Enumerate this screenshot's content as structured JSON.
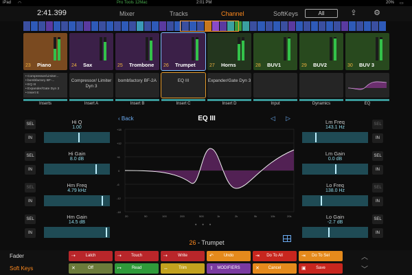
{
  "status": {
    "device": "iPad",
    "wifi": "wifi-icon",
    "app": "Pro Tools 12Mac",
    "time": "2:01 PM",
    "battery": "20%"
  },
  "topbar": {
    "clock": "2:41.399",
    "tabs": [
      {
        "label": "Mixer",
        "active": false
      },
      {
        "label": "Tracks",
        "active": false
      },
      {
        "label": "Channel",
        "active": true
      }
    ],
    "softkeys_label": "SoftKeys",
    "softkeys_value": "All",
    "share_icon": "share-icon",
    "settings_icon": "gear-icon"
  },
  "tracks": [
    {
      "num": "23",
      "name": "Piano",
      "color": "#7a4a20",
      "meters": [
        0.5,
        0.9
      ]
    },
    {
      "num": "24",
      "name": "Sax",
      "color": "#3b2048",
      "meters": [
        0.0,
        0.8
      ]
    },
    {
      "num": "25",
      "name": "Trombone",
      "color": "#3b2048",
      "meters": [
        0.0,
        0.85
      ]
    },
    {
      "num": "26",
      "name": "Trumpet",
      "color": "#3b2048",
      "meters": [
        0.0,
        0.9
      ],
      "selected": true
    },
    {
      "num": "27",
      "name": "Horns",
      "color": "#23361e",
      "meters": [
        0.7,
        0.85
      ]
    },
    {
      "num": "28",
      "name": "BUV1",
      "color": "#28491e",
      "meters": [
        0.0,
        0.95
      ]
    },
    {
      "num": "29",
      "name": "BUV2",
      "color": "#28491e",
      "meters": [
        0.0,
        0.95
      ]
    },
    {
      "num": "30",
      "name": "BUV 3",
      "color": "#28491e",
      "meters": [
        0.0,
        0.9
      ]
    }
  ],
  "inserts": {
    "list": [
      "• Compressor/Limiter...",
      "• bombfactory BF-...",
      "• EQ III",
      "• Expander/Gate Dyn 3",
      "• Insert E"
    ],
    "list_label": "Inserts",
    "items": [
      {
        "text": "Compressor/ Limiter Dyn 3",
        "label": "Insert A"
      },
      {
        "text": "bombfactory BF-2A",
        "label": "Insert B"
      },
      {
        "text": "EQ III",
        "label": "Insert C",
        "selected": true
      },
      {
        "text": "Expander/Gate Dyn 3",
        "label": "Insert D"
      }
    ],
    "extra": [
      {
        "label": "Input"
      },
      {
        "label": "Dynamics"
      },
      {
        "label": "EQ"
      }
    ]
  },
  "left_controls": [
    {
      "btn": "SEL",
      "name": "Hi Q",
      "value": "1.00",
      "pos": 0.52,
      "btn_dim": false
    },
    {
      "btn": "IN",
      "second_btn": true,
      "btn_dim": false
    },
    {
      "btn": "SEL",
      "name": "Hi Gain",
      "value": "8.0 dB",
      "pos": 0.78,
      "btn_dim": false
    },
    {
      "btn": "IN",
      "second_btn": true,
      "btn_dim": false
    },
    {
      "btn": "SEL",
      "name": "Hm Freq",
      "value": "4.79 kHz",
      "pos": 0.88,
      "btn_dim": true
    },
    {
      "btn": "IN",
      "second_btn": true,
      "btn_dim": false
    },
    {
      "btn": "SEL",
      "name": "Hm Gain",
      "value": "14.5 dB",
      "pos": 0.94,
      "btn_dim": false
    },
    {
      "btn": "IN",
      "second_btn": true,
      "btn_dim": false
    }
  ],
  "right_controls": [
    {
      "btn": "SEL",
      "btn2": "IN",
      "name": "Lm Freq",
      "value": "143.1 Hz",
      "pos": 0.2,
      "dim": true
    },
    {
      "btn": "SEL",
      "btn2": "IN",
      "name": "Lm Gain",
      "value": "0.0 dB",
      "pos": 0.5,
      "dim": false
    },
    {
      "btn": "SEL",
      "btn2": "IN",
      "name": "Lo Freq",
      "value": "138.0 Hz",
      "pos": 0.28,
      "dim": true
    },
    {
      "btn": "SEL",
      "btn2": "IN",
      "name": "Lo Gain",
      "value": "-2.7 dB",
      "pos": 0.4,
      "dim": false
    }
  ],
  "eq": {
    "back": "Back",
    "title": "EQ III",
    "prev_icon": "triangle-left-icon",
    "next_icon": "triangle-right-icon",
    "y_ticks": [
      "+18",
      "+12",
      "+6",
      "0",
      "-6",
      "-12",
      "-18"
    ],
    "x_ticks": [
      "20",
      "50",
      "100",
      "200",
      "500",
      "1k",
      "2k",
      "5k",
      "10k",
      "20k"
    ],
    "track_num": "26",
    "track_name": "- Trumpet",
    "page_dots": "• • •"
  },
  "bottom": {
    "fader_label": "Fader",
    "softkeys_label": "Soft Keys",
    "row1": [
      {
        "label": "Latch",
        "color": "#b9262a",
        "icon": "automation-icon"
      },
      {
        "label": "Touch",
        "color": "#b9262a",
        "icon": "automation-icon"
      },
      {
        "label": "Write",
        "color": "#b9262a",
        "icon": "automation-icon"
      },
      {
        "label": "Undo",
        "color": "#e58a1c",
        "icon": "undo-icon"
      },
      {
        "label": "Do To All",
        "color": "#c8261e",
        "icon": "do-to-all-icon"
      },
      {
        "label": "Do To Sel",
        "color": "#e58a1c",
        "icon": "do-to-sel-icon"
      }
    ],
    "row2": [
      {
        "label": "Off",
        "color": "#6b7b3a",
        "icon": "off-icon"
      },
      {
        "label": "Read",
        "color": "#2f9a3a",
        "icon": "read-icon"
      },
      {
        "label": "Trim",
        "color": "#c2a21e",
        "icon": "trim-icon"
      },
      {
        "label": "MODIFIERS",
        "color": "#7a3aa0",
        "icon": "modifiers-icon"
      },
      {
        "label": "Cancel",
        "color": "#e58a1c",
        "icon": "cancel-icon"
      },
      {
        "label": "Save",
        "color": "#c8261e",
        "icon": "save-icon"
      }
    ],
    "up_icon": "chevron-up-icon",
    "down_icon": "chevron-down-icon"
  },
  "strip_colors": [
    "#3a4fa0",
    "#2e5ab8",
    "#3a4fa0",
    "#5a3aa0",
    "#2e5ab8",
    "#3a4fa0",
    "#2e5ab8",
    "#3a4fa0",
    "#5a3aa0",
    "#2e5ab8",
    "#3a4fa0",
    "#2e5ab8",
    "#3a4fa0",
    "#2e5ab8",
    "#3a4fa0",
    "#3a9ab8",
    "#3a4fa0",
    "#2e5ab8",
    "#5a3aa0",
    "#3a4fa0",
    "#2e5ab8",
    "#3a4fa0",
    "#2e5ab8",
    "#3a4fa0",
    "#c8781e",
    "#8a4ac8",
    "#5a3aa0",
    "#3aa0a0",
    "#3a9a3a",
    "#3aa0a0",
    "#3a4fa0",
    "#2e5ab8",
    "#3a4fa0",
    "#2e5ab8",
    "#3a4fa0",
    "#5a3aa0",
    "#2e5ab8",
    "#3a4fa0",
    "#2e5ab8",
    "#3a4fa0",
    "#2e5ab8",
    "#3a4fa0",
    "#5a3aa0",
    "#2e5ab8",
    "#3a4fa0",
    "#2e5ab8",
    "#3a4fa0",
    "#2e5ab8"
  ]
}
